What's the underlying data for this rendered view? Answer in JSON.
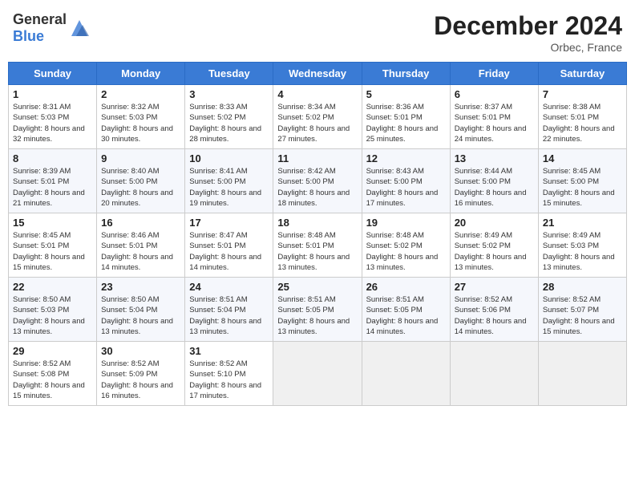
{
  "header": {
    "logo_general": "General",
    "logo_blue": "Blue",
    "title": "December 2024",
    "location": "Orbec, France"
  },
  "days_of_week": [
    "Sunday",
    "Monday",
    "Tuesday",
    "Wednesday",
    "Thursday",
    "Friday",
    "Saturday"
  ],
  "weeks": [
    [
      {
        "day": "1",
        "text": "Sunrise: 8:31 AM\nSunset: 5:03 PM\nDaylight: 8 hours and 32 minutes."
      },
      {
        "day": "2",
        "text": "Sunrise: 8:32 AM\nSunset: 5:03 PM\nDaylight: 8 hours and 30 minutes."
      },
      {
        "day": "3",
        "text": "Sunrise: 8:33 AM\nSunset: 5:02 PM\nDaylight: 8 hours and 28 minutes."
      },
      {
        "day": "4",
        "text": "Sunrise: 8:34 AM\nSunset: 5:02 PM\nDaylight: 8 hours and 27 minutes."
      },
      {
        "day": "5",
        "text": "Sunrise: 8:36 AM\nSunset: 5:01 PM\nDaylight: 8 hours and 25 minutes."
      },
      {
        "day": "6",
        "text": "Sunrise: 8:37 AM\nSunset: 5:01 PM\nDaylight: 8 hours and 24 minutes."
      },
      {
        "day": "7",
        "text": "Sunrise: 8:38 AM\nSunset: 5:01 PM\nDaylight: 8 hours and 22 minutes."
      }
    ],
    [
      {
        "day": "8",
        "text": "Sunrise: 8:39 AM\nSunset: 5:01 PM\nDaylight: 8 hours and 21 minutes."
      },
      {
        "day": "9",
        "text": "Sunrise: 8:40 AM\nSunset: 5:00 PM\nDaylight: 8 hours and 20 minutes."
      },
      {
        "day": "10",
        "text": "Sunrise: 8:41 AM\nSunset: 5:00 PM\nDaylight: 8 hours and 19 minutes."
      },
      {
        "day": "11",
        "text": "Sunrise: 8:42 AM\nSunset: 5:00 PM\nDaylight: 8 hours and 18 minutes."
      },
      {
        "day": "12",
        "text": "Sunrise: 8:43 AM\nSunset: 5:00 PM\nDaylight: 8 hours and 17 minutes."
      },
      {
        "day": "13",
        "text": "Sunrise: 8:44 AM\nSunset: 5:00 PM\nDaylight: 8 hours and 16 minutes."
      },
      {
        "day": "14",
        "text": "Sunrise: 8:45 AM\nSunset: 5:00 PM\nDaylight: 8 hours and 15 minutes."
      }
    ],
    [
      {
        "day": "15",
        "text": "Sunrise: 8:45 AM\nSunset: 5:01 PM\nDaylight: 8 hours and 15 minutes."
      },
      {
        "day": "16",
        "text": "Sunrise: 8:46 AM\nSunset: 5:01 PM\nDaylight: 8 hours and 14 minutes."
      },
      {
        "day": "17",
        "text": "Sunrise: 8:47 AM\nSunset: 5:01 PM\nDaylight: 8 hours and 14 minutes."
      },
      {
        "day": "18",
        "text": "Sunrise: 8:48 AM\nSunset: 5:01 PM\nDaylight: 8 hours and 13 minutes."
      },
      {
        "day": "19",
        "text": "Sunrise: 8:48 AM\nSunset: 5:02 PM\nDaylight: 8 hours and 13 minutes."
      },
      {
        "day": "20",
        "text": "Sunrise: 8:49 AM\nSunset: 5:02 PM\nDaylight: 8 hours and 13 minutes."
      },
      {
        "day": "21",
        "text": "Sunrise: 8:49 AM\nSunset: 5:03 PM\nDaylight: 8 hours and 13 minutes."
      }
    ],
    [
      {
        "day": "22",
        "text": "Sunrise: 8:50 AM\nSunset: 5:03 PM\nDaylight: 8 hours and 13 minutes."
      },
      {
        "day": "23",
        "text": "Sunrise: 8:50 AM\nSunset: 5:04 PM\nDaylight: 8 hours and 13 minutes."
      },
      {
        "day": "24",
        "text": "Sunrise: 8:51 AM\nSunset: 5:04 PM\nDaylight: 8 hours and 13 minutes."
      },
      {
        "day": "25",
        "text": "Sunrise: 8:51 AM\nSunset: 5:05 PM\nDaylight: 8 hours and 13 minutes."
      },
      {
        "day": "26",
        "text": "Sunrise: 8:51 AM\nSunset: 5:05 PM\nDaylight: 8 hours and 14 minutes."
      },
      {
        "day": "27",
        "text": "Sunrise: 8:52 AM\nSunset: 5:06 PM\nDaylight: 8 hours and 14 minutes."
      },
      {
        "day": "28",
        "text": "Sunrise: 8:52 AM\nSunset: 5:07 PM\nDaylight: 8 hours and 15 minutes."
      }
    ],
    [
      {
        "day": "29",
        "text": "Sunrise: 8:52 AM\nSunset: 5:08 PM\nDaylight: 8 hours and 15 minutes."
      },
      {
        "day": "30",
        "text": "Sunrise: 8:52 AM\nSunset: 5:09 PM\nDaylight: 8 hours and 16 minutes."
      },
      {
        "day": "31",
        "text": "Sunrise: 8:52 AM\nSunset: 5:10 PM\nDaylight: 8 hours and 17 minutes."
      },
      null,
      null,
      null,
      null
    ]
  ]
}
